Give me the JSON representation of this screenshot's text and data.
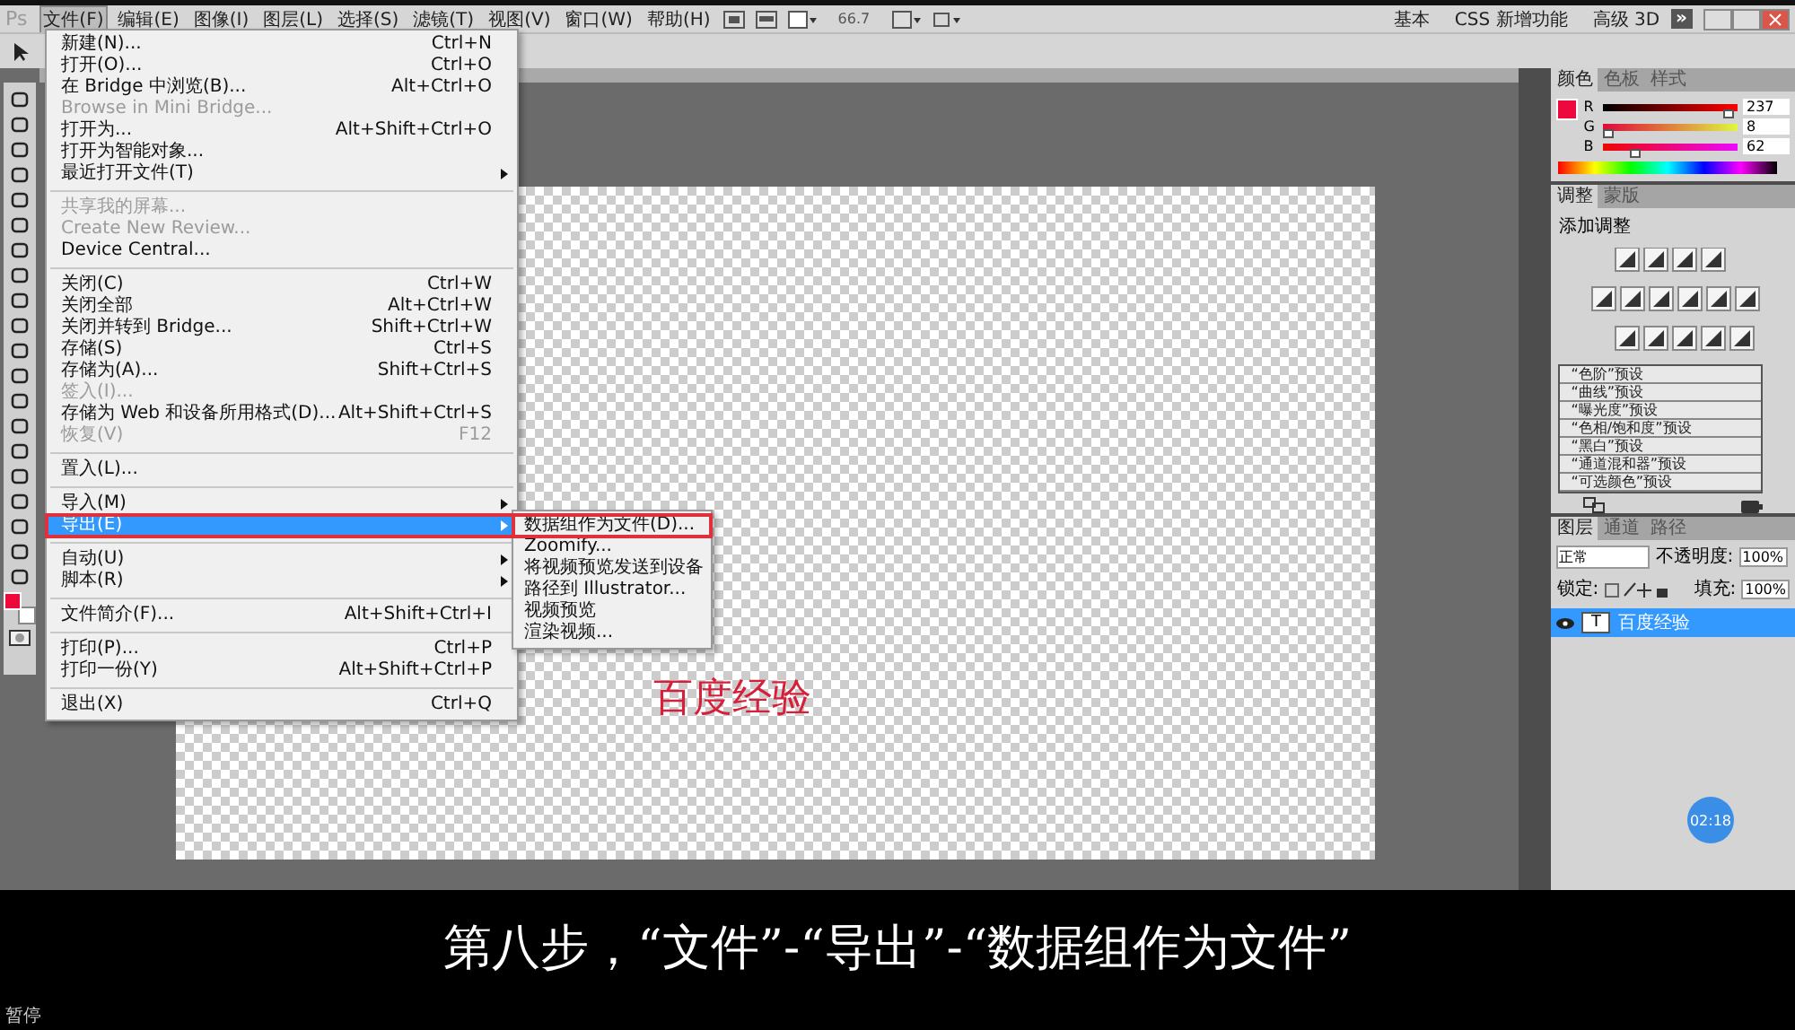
{
  "menu_bar": {
    "logo": "Ps",
    "items": [
      {
        "label": "文件(F)",
        "selected": true
      },
      {
        "label": "编辑(E)",
        "selected": false
      },
      {
        "label": "图像(I)",
        "selected": false
      },
      {
        "label": "图层(L)",
        "selected": false
      },
      {
        "label": "选择(S)",
        "selected": false
      },
      {
        "label": "滤镜(T)",
        "selected": false
      },
      {
        "label": "视图(V)",
        "selected": false
      },
      {
        "label": "窗口(W)",
        "selected": false
      },
      {
        "label": "帮助(H)",
        "selected": false
      }
    ],
    "zoom": "66.7",
    "workspaces": [
      "基本",
      "CSS 新增功能",
      "高级 3D"
    ],
    "more": "»"
  },
  "file_menu": {
    "sections": [
      [
        {
          "label": "新建(N)...",
          "shortcut": "Ctrl+N",
          "disabled": false,
          "submenu": false,
          "selected": false,
          "highlighted": false
        },
        {
          "label": "打开(O)...",
          "shortcut": "Ctrl+O",
          "disabled": false,
          "submenu": false,
          "selected": false,
          "highlighted": false
        },
        {
          "label": "在 Bridge 中浏览(B)...",
          "shortcut": "Alt+Ctrl+O",
          "disabled": false,
          "submenu": false,
          "selected": false,
          "highlighted": false
        },
        {
          "label": "Browse in Mini Bridge...",
          "disabled": true,
          "submenu": false,
          "selected": false,
          "highlighted": false
        },
        {
          "label": "打开为...",
          "shortcut": "Alt+Shift+Ctrl+O",
          "disabled": false,
          "submenu": false,
          "selected": false,
          "highlighted": false
        },
        {
          "label": "打开为智能对象...",
          "disabled": false,
          "submenu": false,
          "selected": false,
          "highlighted": false
        },
        {
          "label": "最近打开文件(T)",
          "disabled": false,
          "submenu": true,
          "selected": false,
          "highlighted": false
        }
      ],
      [
        {
          "label": "共享我的屏幕...",
          "disabled": true,
          "submenu": false,
          "selected": false,
          "highlighted": false
        },
        {
          "label": "Create New Review...",
          "disabled": true,
          "submenu": false,
          "selected": false,
          "highlighted": false
        },
        {
          "label": "Device Central...",
          "disabled": false,
          "submenu": false,
          "selected": false,
          "highlighted": false
        }
      ],
      [
        {
          "label": "关闭(C)",
          "shortcut": "Ctrl+W",
          "disabled": false,
          "submenu": false,
          "selected": false,
          "highlighted": false
        },
        {
          "label": "关闭全部",
          "shortcut": "Alt+Ctrl+W",
          "disabled": false,
          "submenu": false,
          "selected": false,
          "highlighted": false
        },
        {
          "label": "关闭并转到 Bridge...",
          "shortcut": "Shift+Ctrl+W",
          "disabled": false,
          "submenu": false,
          "selected": false,
          "highlighted": false
        },
        {
          "label": "存储(S)",
          "shortcut": "Ctrl+S",
          "disabled": false,
          "submenu": false,
          "selected": false,
          "highlighted": false
        },
        {
          "label": "存储为(A)...",
          "shortcut": "Shift+Ctrl+S",
          "disabled": false,
          "submenu": false,
          "selected": false,
          "highlighted": false
        },
        {
          "label": "签入(I)...",
          "disabled": true,
          "submenu": false,
          "selected": false,
          "highlighted": false
        },
        {
          "label": "存储为 Web 和设备所用格式(D)...",
          "shortcut": "Alt+Shift+Ctrl+S",
          "disabled": false,
          "submenu": false,
          "selected": false,
          "highlighted": false
        },
        {
          "label": "恢复(V)",
          "shortcut": "F12",
          "disabled": true,
          "submenu": false,
          "selected": false,
          "highlighted": false
        }
      ],
      [
        {
          "label": "置入(L)...",
          "disabled": false,
          "submenu": false,
          "selected": false,
          "highlighted": false
        }
      ],
      [
        {
          "label": "导入(M)",
          "disabled": false,
          "submenu": true,
          "selected": false,
          "highlighted": false
        },
        {
          "label": "导出(E)",
          "disabled": false,
          "submenu": true,
          "selected": true,
          "highlighted": true
        }
      ],
      [
        {
          "label": "自动(U)",
          "disabled": false,
          "submenu": true,
          "selected": false,
          "highlighted": false
        },
        {
          "label": "脚本(R)",
          "disabled": false,
          "submenu": true,
          "selected": false,
          "highlighted": false
        }
      ],
      [
        {
          "label": "文件简介(F)...",
          "shortcut": "Alt+Shift+Ctrl+I",
          "disabled": false,
          "submenu": false,
          "selected": false,
          "highlighted": false
        }
      ],
      [
        {
          "label": "打印(P)...",
          "shortcut": "Ctrl+P",
          "disabled": false,
          "submenu": false,
          "selected": false,
          "highlighted": false
        },
        {
          "label": "打印一份(Y)",
          "shortcut": "Alt+Shift+Ctrl+P",
          "disabled": false,
          "submenu": false,
          "selected": false,
          "highlighted": false
        }
      ],
      [
        {
          "label": "退出(X)",
          "shortcut": "Ctrl+Q",
          "disabled": false,
          "submenu": false,
          "selected": false,
          "highlighted": false
        }
      ]
    ]
  },
  "export_submenu": {
    "items": [
      {
        "label": "数据组作为文件(D)...",
        "highlighted": true
      },
      {
        "label": "Zoomify...",
        "highlighted": false
      },
      {
        "label": "将视频预览发送到设备",
        "highlighted": false
      },
      {
        "label": "路径到 Illustrator...",
        "highlighted": false
      },
      {
        "label": "视频预览",
        "highlighted": false
      },
      {
        "label": "渲染视频...",
        "highlighted": false
      }
    ]
  },
  "color_panel": {
    "tabs": [
      {
        "label": "颜色",
        "selected": true
      },
      {
        "label": "色板",
        "selected": false
      },
      {
        "label": "样式",
        "selected": false
      }
    ],
    "channels": [
      {
        "label": "R",
        "value": "237",
        "level": 0.93
      },
      {
        "label": "G",
        "value": "8",
        "level": 0.03
      },
      {
        "label": "B",
        "value": "62",
        "level": 0.24
      }
    ]
  },
  "adjustments_panel": {
    "tabs": [
      {
        "label": "调整",
        "selected": true
      },
      {
        "label": "蒙版",
        "selected": false
      }
    ],
    "title": "添加调整",
    "presets": [
      "“色阶”预设",
      "“曲线”预设",
      "“曝光度”预设",
      "“色相/饱和度”预设",
      "“黑白”预设",
      "“通道混和器”预设",
      "“可选颜色”预设"
    ]
  },
  "layers_panel": {
    "tabs": [
      {
        "label": "图层",
        "selected": true
      },
      {
        "label": "通道",
        "selected": false
      },
      {
        "label": "路径",
        "selected": false
      }
    ],
    "blend_mode": "正常",
    "opacity_label": "不透明度:",
    "opacity": "100%",
    "lock_label": "锁定:",
    "fill_label": "填充:",
    "fill": "100%",
    "layers": [
      {
        "name": "百度经验",
        "kind": "text",
        "thumb": "T",
        "selected": true,
        "visible": true
      }
    ]
  },
  "canvas": {
    "text": "百度经验"
  },
  "timer_badge": "02:18",
  "subtitle": "第八步，“文件”-“导出”-“数据组作为文件”",
  "player_status": "暂停"
}
